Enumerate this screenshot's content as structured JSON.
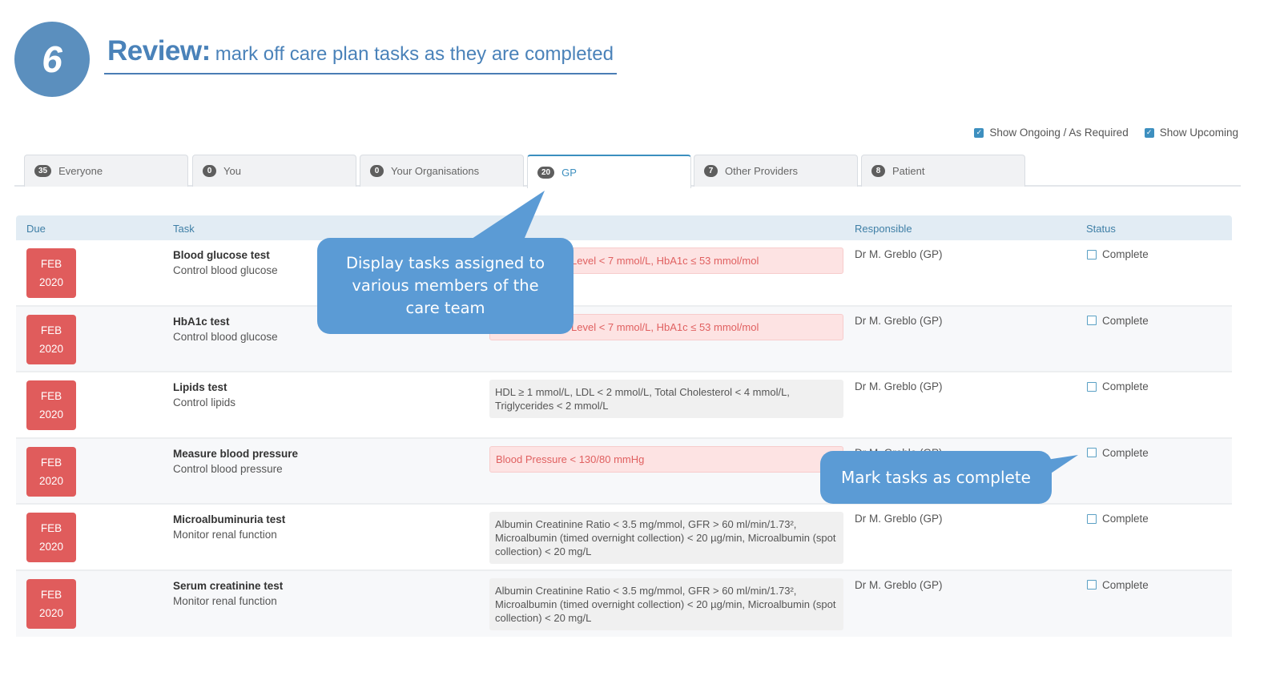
{
  "header": {
    "step_number": "6",
    "title_strong": "Review:",
    "title_sub": "mark off care plan tasks as they are completed"
  },
  "filters": [
    {
      "label": "Show Ongoing / As Required",
      "checked": true
    },
    {
      "label": "Show Upcoming",
      "checked": true
    }
  ],
  "tabs": [
    {
      "count": "35",
      "label": "Everyone",
      "active": false
    },
    {
      "count": "0",
      "label": "You",
      "active": false
    },
    {
      "count": "0",
      "label": "Your Organisations",
      "active": false
    },
    {
      "count": "20",
      "label": "GP",
      "active": true
    },
    {
      "count": "7",
      "label": "Other Providers",
      "active": false
    },
    {
      "count": "8",
      "label": "Patient",
      "active": false
    }
  ],
  "table": {
    "columns": {
      "due": "Due",
      "task": "Task",
      "responsible": "Responsible",
      "status": "Status"
    },
    "rows": [
      {
        "due_month": "FEB",
        "due_year": "2020",
        "task": "Blood glucose test",
        "category": "Control blood glucose",
        "goal": "Level < 7 mmol/L, HbA1c ≤ 53 mmol/mol",
        "goal_style": "red",
        "responsible": "Dr M. Greblo (GP)",
        "status": "Complete"
      },
      {
        "due_month": "FEB",
        "due_year": "2020",
        "task": "HbA1c test",
        "category": "Control blood glucose",
        "goal": "Level < 7 mmol/L, HbA1c ≤ 53 mmol/mol",
        "goal_style": "red",
        "responsible": "Dr M. Greblo (GP)",
        "status": "Complete"
      },
      {
        "due_month": "FEB",
        "due_year": "2020",
        "task": "Lipids test",
        "category": "Control lipids",
        "goal": "HDL ≥ 1 mmol/L, LDL < 2 mmol/L, Total Cholesterol < 4 mmol/L, Triglycerides < 2 mmol/L",
        "goal_style": "gray",
        "responsible": "Dr M. Greblo (GP)",
        "status": "Complete"
      },
      {
        "due_month": "FEB",
        "due_year": "2020",
        "task": "Measure blood pressure",
        "category": "Control blood pressure",
        "goal": "Blood Pressure < 130/80 mmHg",
        "goal_style": "red-full",
        "responsible": "Dr M. Greblo (GP)",
        "status": "Complete"
      },
      {
        "due_month": "FEB",
        "due_year": "2020",
        "task": "Microalbuminuria test",
        "category": "Monitor renal function",
        "goal": "Albumin Creatinine Ratio < 3.5 mg/mmol, GFR > 60 ml/min/1.73², Microalbumin (timed overnight collection) < 20 µg/min, Microalbumin (spot collection) < 20 mg/L",
        "goal_style": "gray",
        "responsible": "Dr M. Greblo (GP)",
        "status": "Complete"
      },
      {
        "due_month": "FEB",
        "due_year": "2020",
        "task": "Serum creatinine test",
        "category": "Monitor renal function",
        "goal": "Albumin Creatinine Ratio < 3.5 mg/mmol, GFR > 60 ml/min/1.73², Microalbumin (timed overnight collection) < 20 µg/min, Microalbumin (spot collection) < 20 mg/L",
        "goal_style": "gray",
        "responsible": "Dr M. Greblo (GP)",
        "status": "Complete"
      }
    ]
  },
  "callouts": [
    {
      "text": "Display tasks assigned to various members of the care team"
    },
    {
      "text": "Mark tasks as complete"
    }
  ],
  "colors": {
    "accent": "#3d8fbf",
    "heading": "#4a82b9",
    "callout": "#5b9bd5",
    "due_badge": "#e05c5c",
    "goal_red_bg": "#fde3e3",
    "goal_red_text": "#e06060"
  }
}
